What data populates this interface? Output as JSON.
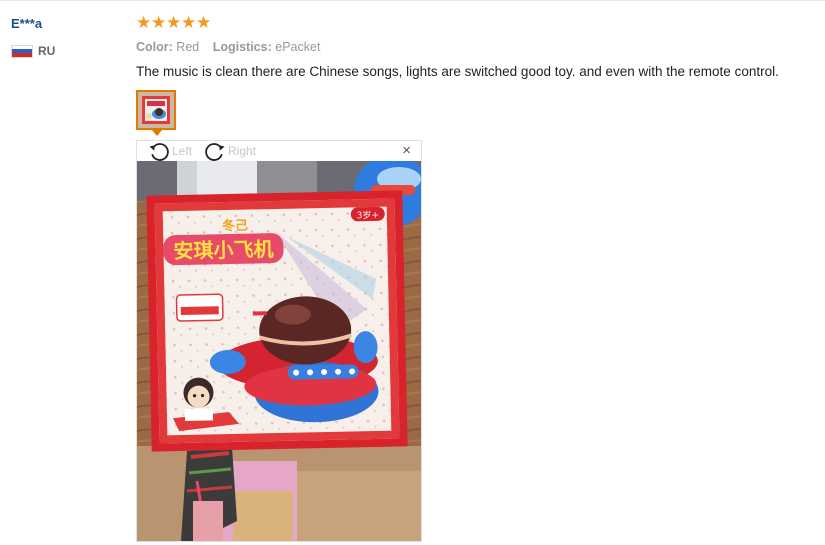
{
  "review": {
    "buyer_name": "E***a",
    "country_code": "RU",
    "flag_colors": [
      "#ffffff",
      "#2b5fc2",
      "#d52b1e"
    ],
    "rating": 5,
    "stars": [
      "★",
      "★",
      "★",
      "★",
      "★"
    ],
    "star_color": "#f39a1e",
    "color_label": "Color:",
    "color_value": "Red",
    "logistics_label": "Logistics:",
    "logistics_value": "ePacket",
    "text": "The music is clean there are Chinese songs, lights are switched good toy. and even with the remote control."
  },
  "viewer": {
    "rotate_left_label": "Left",
    "rotate_right_label": "Right",
    "close_glyph": "×",
    "accent_color": "#e07b00"
  },
  "photo": {
    "box_title_text": "安琪小飞机",
    "box_top_text": "冬己",
    "box_badge_text": "3岁+"
  }
}
